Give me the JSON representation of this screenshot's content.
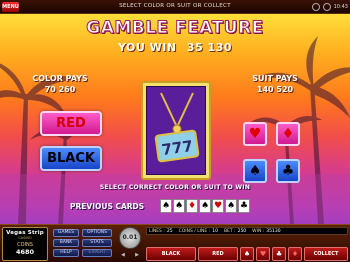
{
  "topbar": {
    "menu_label": "MENU",
    "instruction": "SELECT COLOR OR SUIT OR COLLECT",
    "clock": "10:43"
  },
  "game": {
    "title": "GAMBLE FEATURE",
    "win_label": "YOU WIN",
    "win_amount": "35 130",
    "color_pays_label": "COLOR PAYS",
    "color_pays_value": "70 260",
    "suit_pays_label": "SUIT PAYS",
    "suit_pays_value": "140 520",
    "red_button": "RED",
    "black_button": "BLACK",
    "suits": [
      "♥",
      "♦",
      "♠",
      "♣"
    ],
    "instruction": "SELECT CORRECT COLOR OR SUIT TO WIN",
    "previous_cards_label": "PREVIOUS CARDS",
    "previous_cards": [
      "♠",
      "♠",
      "♦",
      "♠",
      "♥",
      "♠",
      "♣"
    ],
    "previous_cards_colors": [
      "black",
      "black",
      "red",
      "black",
      "red",
      "black",
      "black"
    ]
  },
  "console": {
    "logo_title": "Vegas Strip",
    "logo_subtitle": "CASINO",
    "coins_label": "COINS",
    "coins_value": "4680",
    "menu": {
      "games": "GAMES",
      "options": "OPTIONS",
      "bank": "BANK",
      "stats": "STATS",
      "help": "HELP",
      "expert": "EXPERT"
    },
    "coin_size": "0.01",
    "lines_label": "LINES :",
    "lines_value": "25",
    "coins_line_label": "COINS / LINE :",
    "coins_line_value": "10",
    "bet_label": "BET :",
    "bet_value": "250",
    "win_label": "WIN :",
    "win_value": "35130",
    "black_button": "BLACK",
    "red_button": "RED",
    "collect_button": "COLLECT",
    "suit_buttons": [
      "♠",
      "♥",
      "♣",
      "♦"
    ]
  },
  "colors": {
    "red_button": "#d01a90",
    "black_button": "#1745c8",
    "sky_top": "#ffde3a",
    "sky_bottom": "#9b3fcc"
  }
}
